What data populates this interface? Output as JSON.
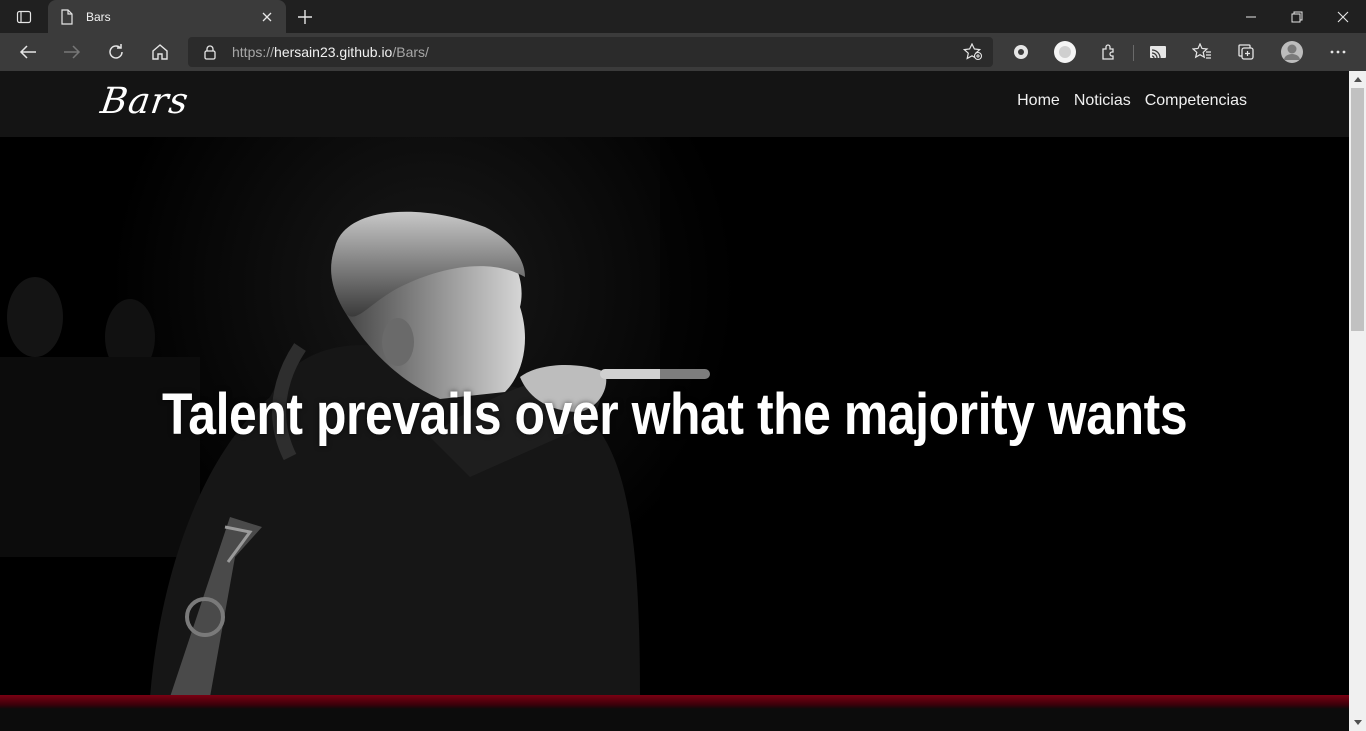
{
  "browser": {
    "tab_title": "Bars",
    "url_scheme": "https://",
    "url_host": "hersain23.github.io",
    "url_path": "/Bars/",
    "accent": "#3b3b3b"
  },
  "site": {
    "logo": "Bars",
    "nav": [
      {
        "label": "Home"
      },
      {
        "label": "Noticias"
      },
      {
        "label": "Competencias"
      }
    ],
    "hero": {
      "headline": "Talent prevails over what the majority wants",
      "band_color": "#7a0012"
    }
  }
}
